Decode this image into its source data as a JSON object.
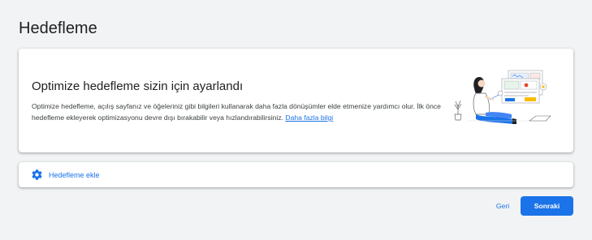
{
  "page": {
    "title": "Hedefleme"
  },
  "info": {
    "heading": "Optimize hedefleme sizin için ayarlandı",
    "description": "Optimize hedefleme, açılış sayfanız ve öğeleriniz gibi bilgileri kullanarak daha fazla dönüşümler elde etmenize yardımcı olur. İlk önce hedefleme ekleyerek optimizasyonu devre dışı bırakabilir veya hızlandırabilirsiniz.",
    "link_label": "Daha fazla bilgi",
    "illustration_icon": "person-with-laptop-illustration"
  },
  "add_targeting": {
    "label": "Hedefleme ekle",
    "icon": "gear-icon"
  },
  "footer": {
    "back_label": "Geri",
    "next_label": "Sonraki"
  },
  "colors": {
    "accent": "#1a73e8",
    "background": "#f1f3f4",
    "card": "#ffffff",
    "text_primary": "#202124",
    "text_secondary": "#3c4043"
  }
}
